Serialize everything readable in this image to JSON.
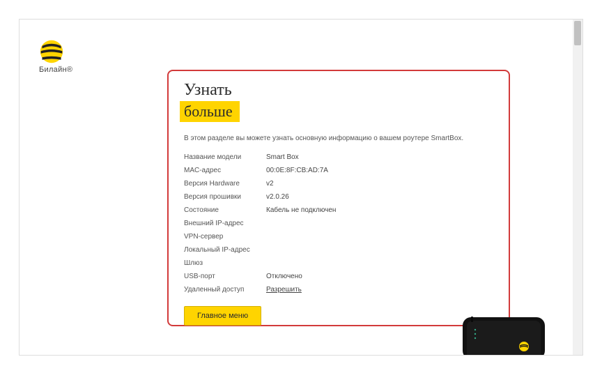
{
  "brand": "Билайн",
  "brand_tm": "®",
  "card": {
    "title_top": "Узнать",
    "title_bottom": "больше",
    "description": "В этом разделе вы можете узнать основную информацию о вашем роутере SmartBox.",
    "rows": [
      {
        "label": "Название модели",
        "value": "Smart Box"
      },
      {
        "label": "MAC-адрес",
        "value": "00:0E:8F:CB:AD:7A"
      },
      {
        "label": "Версия Hardware",
        "value": "v2"
      },
      {
        "label": "Версия прошивки",
        "value": "v2.0.26"
      },
      {
        "label": "Состояние",
        "value": "Кабель не подключен"
      },
      {
        "label": "Внешний IP-адрес",
        "value": ""
      },
      {
        "label": "VPN-сервер",
        "value": ""
      },
      {
        "label": "Локальный IP-адрес",
        "value": ""
      },
      {
        "label": "Шлюз",
        "value": ""
      },
      {
        "label": "USB-порт",
        "value": "Отключено"
      },
      {
        "label": "Удаленный доступ",
        "value": "Разрешить",
        "link": true
      }
    ],
    "main_menu_btn": "Главное меню"
  }
}
